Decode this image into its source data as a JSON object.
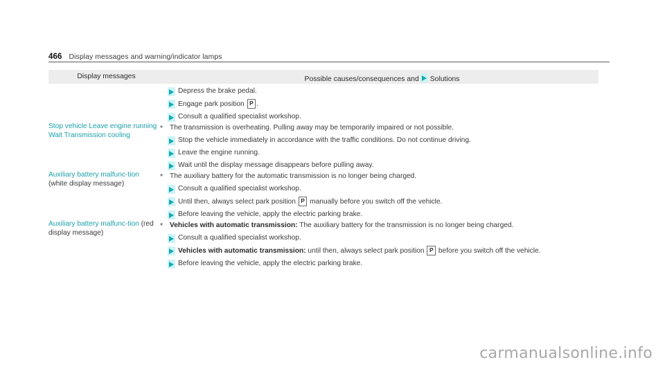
{
  "page": {
    "number": "466",
    "running_title": "Display messages and warning/indicator lamps",
    "watermark": "carmanualsonline.info"
  },
  "table": {
    "headers": {
      "col1": "Display messages",
      "col2_prefix": "Possible causes/consequences and",
      "col2_suffix": "Solutions"
    },
    "symbols": {
      "park_position": "P",
      "asterisk": "*",
      "solution_marker": "solution-triangle"
    },
    "rows": [
      {
        "message_name": "",
        "message_note": "",
        "lead": "",
        "solutions": [
          {
            "pre": "Depress the brake pedal.",
            "box": "",
            "post": ""
          },
          {
            "pre": "Engage park position",
            "box": "P",
            "post": "."
          },
          {
            "pre": "Consult a qualified specialist workshop.",
            "box": "",
            "post": ""
          }
        ]
      },
      {
        "message_name": "Stop vehicle Leave engine running Wait Transmission cooling",
        "message_note": "",
        "lead": "The transmission is overheating. Pulling away may be temporarily impaired or not possible.",
        "solutions": [
          {
            "pre": "Stop the vehicle immediately in accordance with the traffic conditions. Do not continue driving.",
            "box": "",
            "post": ""
          },
          {
            "pre": "Leave the engine running.",
            "box": "",
            "post": ""
          },
          {
            "pre": "Wait until the display message disappears before pulling away.",
            "box": "",
            "post": ""
          }
        ]
      },
      {
        "message_name": "Auxiliary battery malfunc-tion",
        "message_note": " (white display message)",
        "lead": "The auxiliary battery for the automatic transmission is no longer being charged.",
        "solutions": [
          {
            "pre": "Consult a qualified specialist workshop.",
            "box": "",
            "post": ""
          },
          {
            "pre": "Until then, always select park position",
            "box": "P",
            "post": "manually before you switch off the vehicle."
          },
          {
            "pre": "Before leaving the vehicle, apply the electric parking brake.",
            "box": "",
            "post": ""
          }
        ]
      },
      {
        "message_name": "Auxiliary battery malfunc-tion",
        "message_note": " (red display message)",
        "lead_bold": "Vehicles with automatic transmission:",
        "lead": "The auxiliary battery for the transmission is no longer being charged.",
        "solutions": [
          {
            "pre": "Consult a qualified specialist workshop.",
            "box": "",
            "post": ""
          },
          {
            "bold": "Vehicles with automatic transmission:",
            "pre": "until then, always select park position",
            "box": "P",
            "post": "before you switch off the vehicle."
          },
          {
            "pre": "Before leaving the vehicle, apply the electric parking brake.",
            "box": "",
            "post": ""
          }
        ]
      }
    ]
  },
  "colors": {
    "accent_teal": "#1aa0aa",
    "marker_teal": "#13a9b1",
    "marker_bg": "#ccf3f5",
    "header_bg": "#ededed",
    "grid": "#d6d6d6",
    "text": "#3a3a3a",
    "watermark": "#a8a8a8"
  }
}
